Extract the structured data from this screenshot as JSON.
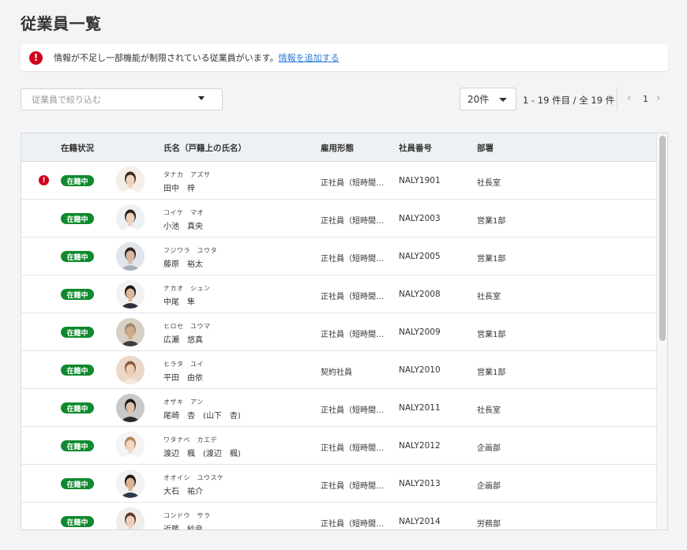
{
  "page": {
    "title": "従業員一覧"
  },
  "alert": {
    "message": "情報が不足し一部機能が制限されている従業員がいます。",
    "link": "情報を追加する",
    "icon": "alert-icon"
  },
  "filter": {
    "placeholder": "従業員で絞り込む"
  },
  "pagination": {
    "per_page": "20件",
    "range": "1 - 19 件目 /  全 19 件",
    "current_page": "1",
    "prev": "‹",
    "next": "›"
  },
  "table": {
    "headers": {
      "status": "在籍状況",
      "name": "氏名（戸籍上の氏名）",
      "type": "雇用形態",
      "number": "社員番号",
      "dept": "部署"
    },
    "rows": [
      {
        "alert": "!",
        "status": "在籍中",
        "kana": "タナカ　アズサ",
        "name": "田中　梓",
        "type": "正社員（短時間…",
        "number": "NALY1901",
        "dept": "社長室",
        "avatar": {
          "bg": "#f4eee8",
          "hair": "#3b2a20",
          "skin": "#f1d4c0",
          "cloth": "#ffffff"
        }
      },
      {
        "alert": "",
        "status": "在籍中",
        "kana": "コイケ　マオ",
        "name": "小池　真央",
        "type": "正社員（短時間…",
        "number": "NALY2003",
        "dept": "営業1部",
        "avatar": {
          "bg": "#eef1f4",
          "hair": "#2b2018",
          "skin": "#f0d0bc",
          "cloth": "#ffffff"
        }
      },
      {
        "alert": "",
        "status": "在籍中",
        "kana": "フジワラ　ユウタ",
        "name": "藤原　裕太",
        "type": "正社員（短時間…",
        "number": "NALY2005",
        "dept": "営業1部",
        "avatar": {
          "bg": "#dfe5ea",
          "hair": "#2b2620",
          "skin": "#d9b8a0",
          "cloth": "#a7b0b8"
        }
      },
      {
        "alert": "",
        "status": "在籍中",
        "kana": "ナカオ　シュン",
        "name": "中尾　隼",
        "type": "正社員（短時間…",
        "number": "NALY2008",
        "dept": "社長室",
        "avatar": {
          "bg": "#f2f2f2",
          "hair": "#1e1a18",
          "skin": "#dcb89c",
          "cloth": "#2b2f3a"
        }
      },
      {
        "alert": "",
        "status": "在籍中",
        "kana": "ヒロセ　ユウマ",
        "name": "広瀬　悠真",
        "type": "正社員（短時間…",
        "number": "NALY2009",
        "dept": "営業1部",
        "avatar": {
          "bg": "#d8d0c4",
          "hair": "#a08b72",
          "skin": "#d2a98a",
          "cloth": "#3c3c3c"
        }
      },
      {
        "alert": "",
        "status": "在籍中",
        "kana": "ヒラタ　ユイ",
        "name": "平田　由依",
        "type": "契約社員",
        "number": "NALY2010",
        "dept": "営業1部",
        "avatar": {
          "bg": "#ecd8c8",
          "hair": "#8a5a38",
          "skin": "#f0cdb4",
          "cloth": "#f5e9dc"
        }
      },
      {
        "alert": "",
        "status": "在籍中",
        "kana": "オザキ　アン",
        "name": "尾崎　杏　(山下　杏)",
        "type": "正社員（短時間…",
        "number": "NALY2011",
        "dept": "社長室",
        "avatar": {
          "bg": "#c9c9c9",
          "hair": "#1d1b1a",
          "skin": "#e2c0a6",
          "cloth": "#2a2a2a"
        }
      },
      {
        "alert": "",
        "status": "在籍中",
        "kana": "ワタナベ　カエデ",
        "name": "渡辺　楓　(渡辺　楓)",
        "type": "正社員（短時間…",
        "number": "NALY2012",
        "dept": "企画部",
        "avatar": {
          "bg": "#f4f4f4",
          "hair": "#b0865a",
          "skin": "#f2d6c4",
          "cloth": "#ffffff"
        }
      },
      {
        "alert": "",
        "status": "在籍中",
        "kana": "オオイシ　ユウスケ",
        "name": "大石　祐介",
        "type": "正社員（短時間…",
        "number": "NALY2013",
        "dept": "企画部",
        "avatar": {
          "bg": "#f2f2f2",
          "hair": "#1c1a19",
          "skin": "#d9b497",
          "cloth": "#2e3a4c"
        }
      },
      {
        "alert": "",
        "status": "在籍中",
        "kana": "コンドウ　サラ",
        "name": "近藤　紗良",
        "type": "正社員（短時間…",
        "number": "NALY2014",
        "dept": "労務部",
        "avatar": {
          "bg": "#f0eceb",
          "hair": "#5a3a2c",
          "skin": "#f0cfbb",
          "cloth": "#c86a7a"
        }
      }
    ]
  }
}
